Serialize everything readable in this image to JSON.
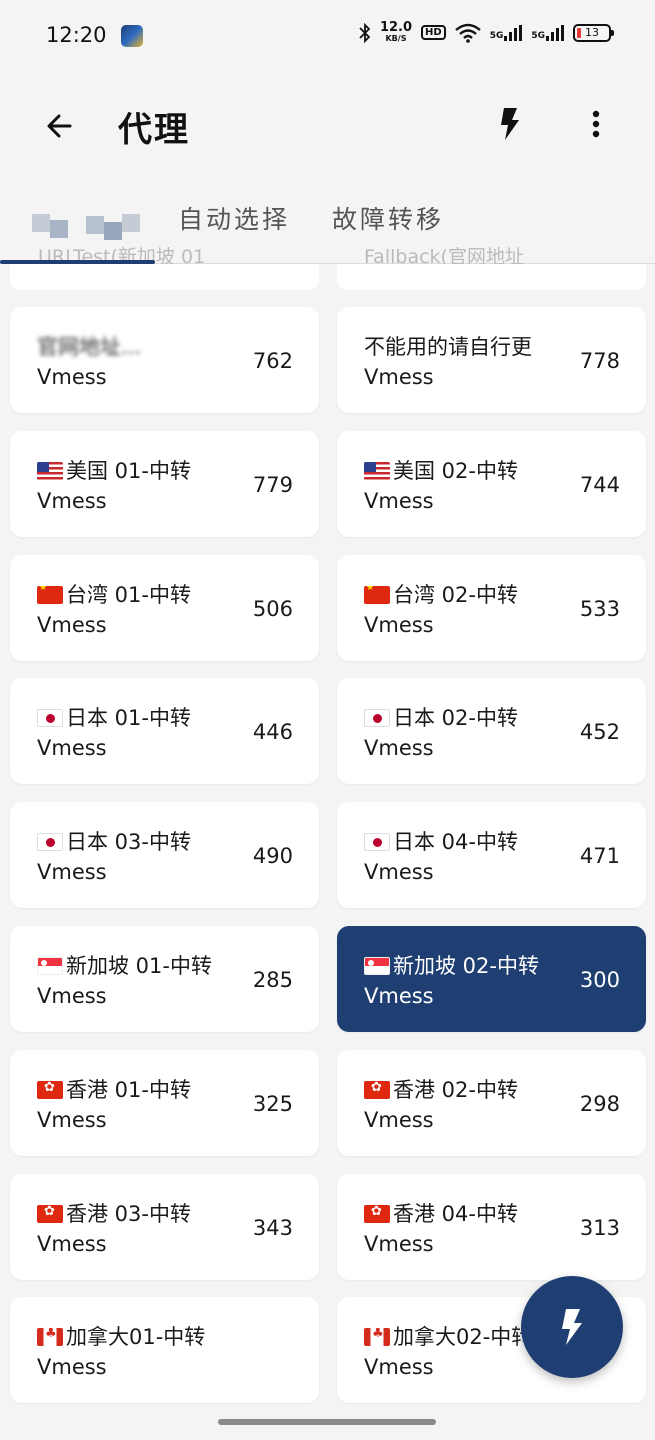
{
  "status": {
    "time": "12:20",
    "speed_top": "12.0",
    "speed_unit": "KB/S",
    "hd": "HD",
    "net1": "5G",
    "net2": "5G",
    "battery": "13"
  },
  "appbar": {
    "title": "代理"
  },
  "tabs": [
    {
      "label": "",
      "sub": "URLTest(新加坡 01"
    },
    {
      "label": "自动选择",
      "sub": ""
    },
    {
      "label": "故障转移",
      "sub": "Fallback(官网地址"
    }
  ],
  "proxies": [
    {
      "name": "官网地址...",
      "type": "Vmess",
      "delay": "762",
      "flag": "",
      "blurred": true
    },
    {
      "name": "不能用的请自行更",
      "type": "Vmess",
      "delay": "778",
      "flag": ""
    },
    {
      "name": "美国 01-中转",
      "type": "Vmess",
      "delay": "779",
      "flag": "us"
    },
    {
      "name": "美国 02-中转",
      "type": "Vmess",
      "delay": "744",
      "flag": "us"
    },
    {
      "name": "台湾 01-中转",
      "type": "Vmess",
      "delay": "506",
      "flag": "cn"
    },
    {
      "name": "台湾 02-中转",
      "type": "Vmess",
      "delay": "533",
      "flag": "cn"
    },
    {
      "name": "日本 01-中转",
      "type": "Vmess",
      "delay": "446",
      "flag": "jp"
    },
    {
      "name": "日本 02-中转",
      "type": "Vmess",
      "delay": "452",
      "flag": "jp"
    },
    {
      "name": "日本 03-中转",
      "type": "Vmess",
      "delay": "490",
      "flag": "jp"
    },
    {
      "name": "日本 04-中转",
      "type": "Vmess",
      "delay": "471",
      "flag": "jp"
    },
    {
      "name": "新加坡 01-中转",
      "type": "Vmess",
      "delay": "285",
      "flag": "sg"
    },
    {
      "name": "新加坡 02-中转",
      "type": "Vmess",
      "delay": "300",
      "flag": "sg",
      "selected": true
    },
    {
      "name": "香港 01-中转",
      "type": "Vmess",
      "delay": "325",
      "flag": "hk"
    },
    {
      "name": "香港 02-中转",
      "type": "Vmess",
      "delay": "298",
      "flag": "hk"
    },
    {
      "name": "香港 03-中转",
      "type": "Vmess",
      "delay": "343",
      "flag": "hk"
    },
    {
      "name": "香港 04-中转",
      "type": "Vmess",
      "delay": "313",
      "flag": "hk"
    },
    {
      "name": "加拿大01-中转",
      "type": "Vmess",
      "delay": "",
      "flag": "ca"
    },
    {
      "name": "加拿大02-中转",
      "type": "Vmess",
      "delay": "",
      "flag": "ca"
    }
  ],
  "colors": {
    "accent": "#1f3f73",
    "background": "#f4f4f4",
    "card": "#ffffff"
  },
  "icons": {
    "back": "arrow-left-icon",
    "test": "lightning-bolt-icon",
    "more": "more-vert-icon",
    "fab": "lightning-bolt-icon"
  }
}
